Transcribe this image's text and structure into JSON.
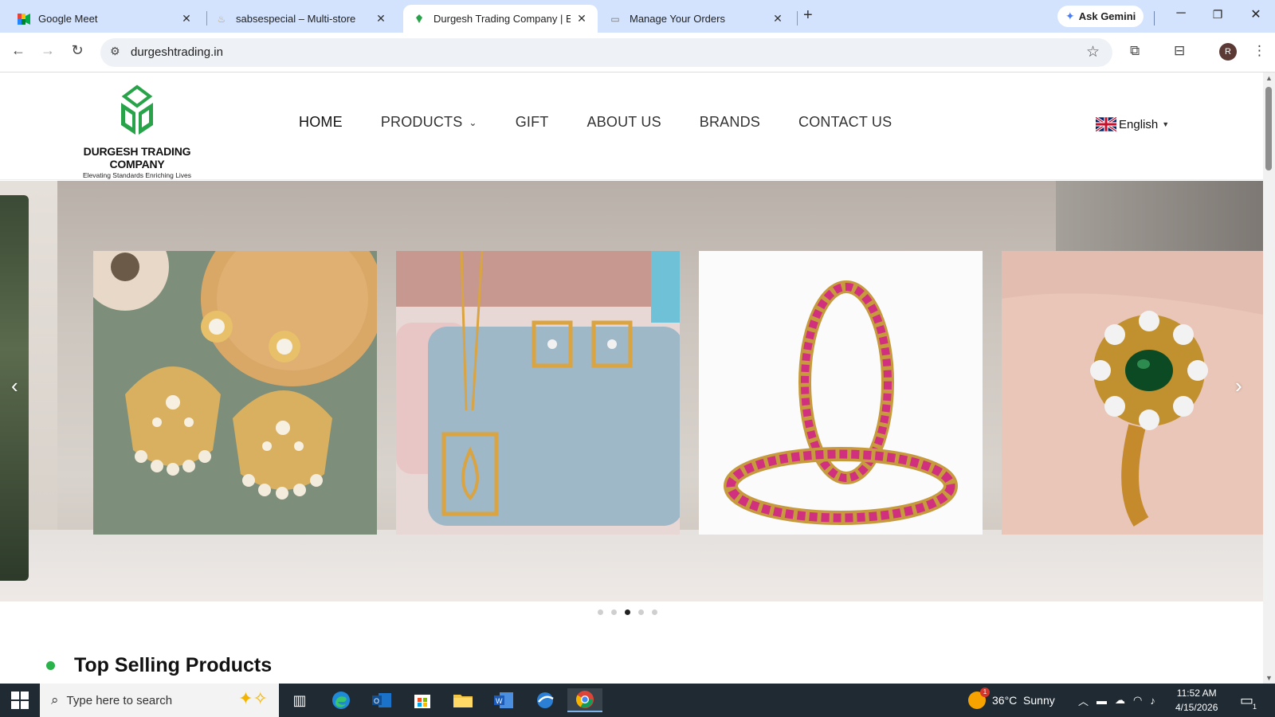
{
  "browser": {
    "tabs": [
      {
        "title": "Google Meet",
        "icon": "google-meet-icon"
      },
      {
        "title": "sabsespecial – Multi-store",
        "icon": "store-icon"
      },
      {
        "title": "Durgesh Trading Company | Exp",
        "icon": "durgesh-leaf-icon",
        "active": true
      },
      {
        "title": "Manage Your Orders",
        "icon": "orders-icon"
      }
    ],
    "ask_gemini": "Ask Gemini",
    "url": "durgeshtrading.in",
    "profile_initial": "R"
  },
  "site": {
    "logo_name": "DURGESH TRADING COMPANY",
    "logo_tagline": "Elevating Standards Enriching Lives",
    "nav": [
      "HOME",
      "PRODUCTS",
      "GIFT",
      "ABOUT US",
      "BRANDS",
      "CONTACT US"
    ],
    "language": "English",
    "carousel": {
      "slides": [
        "kundan-earrings",
        "pendant-set",
        "pink-bangles",
        "emerald-ring"
      ],
      "dot_count": 5,
      "active_dot": 3
    },
    "section_title": "Top Selling Products"
  },
  "taskbar": {
    "search_placeholder": "Type here to search",
    "weather": "36°C  Sunny",
    "weather_badge": "1",
    "time": "11:52 AM",
    "date": "4/15/2026",
    "notification_count": "1"
  },
  "colors": {
    "brand_green": "#29a34a",
    "tabstrip": "#d3e3fd",
    "taskbar": "#1f2a33"
  }
}
